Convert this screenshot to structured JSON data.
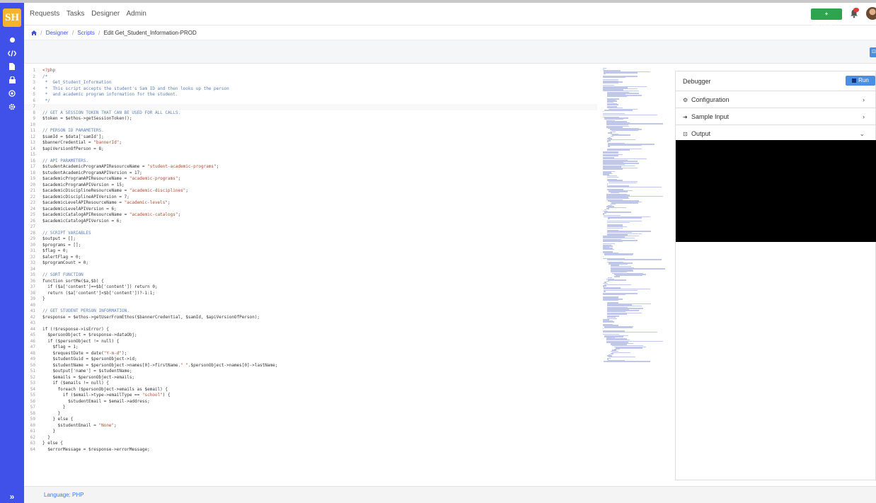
{
  "app": {
    "logo_text": "SH"
  },
  "nav": {
    "items": [
      "Requests",
      "Tasks",
      "Designer",
      "Admin"
    ],
    "request_button": "+ REQUEST"
  },
  "breadcrumb": {
    "items": [
      "Designer",
      "Scripts"
    ],
    "current": "Edit Get_Student_Information-PROD"
  },
  "toolbar": {
    "button_icon": "⊡"
  },
  "editor": {
    "lines": [
      "<?php",
      "/*",
      " *  Get_Student_Information",
      " *  This script accepts the student's Sam ID and then looks up the person",
      " *  and academic program information for the student.",
      " */",
      "",
      "// GET A SESSION TOKEN THAT CAN BE USED FOR ALL CALLS.",
      "$token = $ethos->getSessionToken();",
      "",
      "// PERSON ID PARAMETERS.",
      "$samId = $data['samId'];",
      "$bannerCredential = \"bannerId\";",
      "$apiVersionOfPerson = 8;",
      "",
      "// API PARAMETERS.",
      "$studentAcademicProgramAPIResourceName = \"student-academic-programs\";",
      "$studentAcademicProgramAPIVersion = 17;",
      "$academicProgramAPIResourceName = \"academic-programs\";",
      "$academicProgramAPIVersion = 15;",
      "$academicDisciplineResourceName = \"academic-disciplines\";",
      "$academicDisciplineAPIVersion = 7;",
      "$academicLevelAPIResourceName = \"academic-levels\";",
      "$academicLevelAPIVersion = 6;",
      "$academicCatalogAPIResourceName = \"academic-catalogs\";",
      "$academicCatalogAPIVersion = 6;",
      "",
      "// SCRIPT VARIABLES",
      "$output = [];",
      "$programs = [];",
      "$flag = 0;",
      "$alertFlag = 0;",
      "$programCount = 0;",
      "",
      "// SORT FUNCTION",
      "function sortMe($a,$b) {",
      "  if ($a['content']==$b['content']) return 0;",
      "  return ($a['content']<$b['content'])?-1:1;",
      "}",
      "",
      "// GET STUDENT PERSON INFORMATION.",
      "$response = $ethos->getUserFromEthos($bannerCredential, $samId, $apiVersionOfPerson);",
      "",
      "if (!$response->isError) {",
      "  $personObject = $response->dataObj;",
      "  if ($personObject != null) {",
      "    $flag = 1;",
      "    $requestDate = date(\"Y-m-d\");",
      "    $studentGuid = $personObject->id;",
      "    $studentName = $personObject->names[0]->firstName.\" \".$personObject->names[0]->lastName;",
      "    $output['name'] = $studentName;",
      "    $emails = $personObject->emails;",
      "    if ($emails != null) {",
      "      foreach ($personObject->emails as $email) {",
      "        if ($email->type->emailType == \"school\") {",
      "          $studentEmail = $email->address;",
      "        }",
      "      }",
      "    } else {",
      "      $studentEmail = \"None\";",
      "    }",
      "  }",
      "} else {",
      "  $errorMessage = $response->errorMessage;"
    ]
  },
  "debugger": {
    "title": "Debugger",
    "run_label": "Run",
    "sections": [
      {
        "label": "Configuration",
        "icon": "gear-icon",
        "chevron": "›"
      },
      {
        "label": "Sample Input",
        "icon": "sign-in-icon",
        "chevron": "›"
      },
      {
        "label": "Output",
        "icon": "output-icon",
        "chevron": "⌄"
      }
    ]
  },
  "footer": {
    "language": "Language: PHP"
  },
  "colors": {
    "sidebar": "#3f51e8",
    "accent_green": "#2ea44f",
    "run_blue": "#4b8fe2",
    "php_tag": "#c0392b",
    "comment": "#5c7fb8",
    "string": "#b04a2f"
  }
}
